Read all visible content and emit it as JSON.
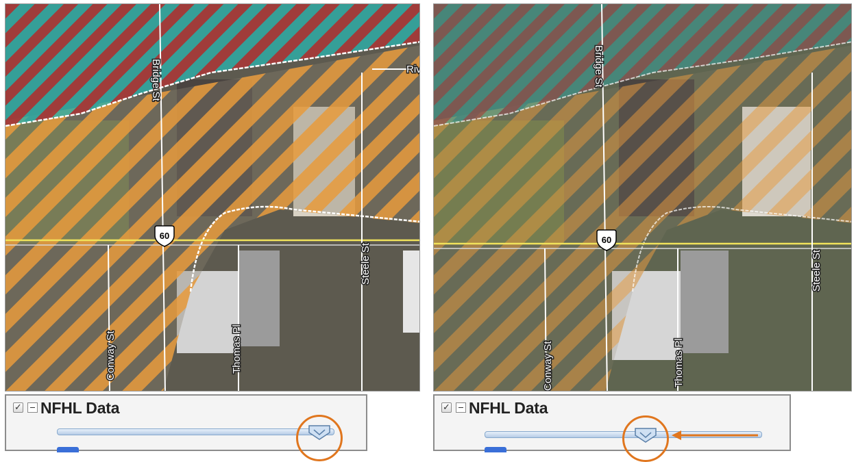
{
  "panels": [
    {
      "id": "before",
      "layer": {
        "checkbox_checked": true,
        "title": "NFHL Data",
        "transparency_fraction": 0.9
      },
      "map": {
        "street_labels": {
          "bridge": "Bridge St",
          "river": "Riv",
          "steele": "Steele St",
          "conway": "Conway St",
          "thomas": "Thomas Pl"
        },
        "route_shield": "60"
      }
    },
    {
      "id": "after",
      "layer": {
        "checkbox_checked": true,
        "title": "NFHL Data",
        "transparency_fraction": 0.58
      },
      "map": {
        "street_labels": {
          "bridge": "Bridge St",
          "steele": "Steele St",
          "conway": "Conway St",
          "thomas": "Thomas Pl"
        },
        "route_shield": "60"
      }
    }
  ],
  "legend_colors": {
    "floodway_red": "#b32a2a",
    "floodway_teal": "#2bb0aa",
    "flood_zone_orange": "#e89a3c",
    "highlight_orange": "#e0761e"
  }
}
